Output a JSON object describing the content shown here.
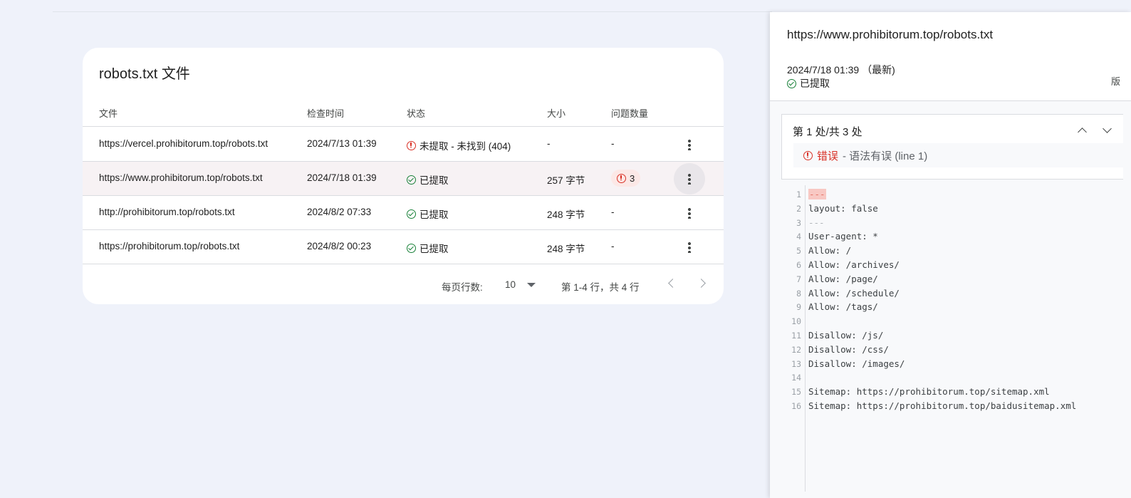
{
  "card": {
    "title": "robots.txt 文件",
    "columns": [
      "文件",
      "检查时间",
      "状态",
      "大小",
      "问题数量"
    ],
    "rows": [
      {
        "file": "https://vercel.prohibitorum.top/robots.txt",
        "time": "2024/7/13 01:39",
        "status": "未提取 - 未找到 (404)",
        "status_type": "error",
        "size": "-",
        "issues": "-"
      },
      {
        "file": "https://www.prohibitorum.top/robots.txt",
        "time": "2024/7/18 01:39",
        "status": "已提取",
        "status_type": "ok",
        "size": "257 字节",
        "issues": "3"
      },
      {
        "file": "http://prohibitorum.top/robots.txt",
        "time": "2024/8/2 07:33",
        "status": "已提取",
        "status_type": "ok",
        "size": "248 字节",
        "issues": "-"
      },
      {
        "file": "https://prohibitorum.top/robots.txt",
        "time": "2024/8/2 00:23",
        "status": "已提取",
        "status_type": "ok",
        "size": "248 字节",
        "issues": "-"
      }
    ],
    "pager": {
      "rows_per_page_label": "每页行数:",
      "rows_per_page": "10",
      "range": "第 1-4 行，共 4 行"
    }
  },
  "panel": {
    "url": "https://www.prohibitorum.top/robots.txt",
    "date": "2024/7/18 01:39 （最新)",
    "status": "已提取",
    "cut_label": "版",
    "issue_count": "第 1 处/共 3 处",
    "issue_type": "错误",
    "issue_desc": " - 语法有误 (line 1)",
    "code_lines": [
      "---",
      "layout: false",
      "---",
      "User-agent: *",
      "Allow: /",
      "Allow: /archives/",
      "Allow: /page/",
      "Allow: /schedule/",
      "Allow: /tags/",
      "",
      "Disallow: /js/",
      "Disallow: /css/",
      "Disallow: /images/",
      "",
      "Sitemap: https://prohibitorum.top/sitemap.xml",
      "Sitemap: https://prohibitorum.top/baidusitemap.xml"
    ],
    "line_numbers": [
      "1",
      "2",
      "3",
      "4",
      "5",
      "6",
      "7",
      "8",
      "9",
      "10",
      "11",
      "12",
      "13",
      "14",
      "15",
      "16"
    ]
  },
  "colors": {
    "ok": "#188038",
    "error": "#d93025",
    "bg": "#eff2fa"
  }
}
